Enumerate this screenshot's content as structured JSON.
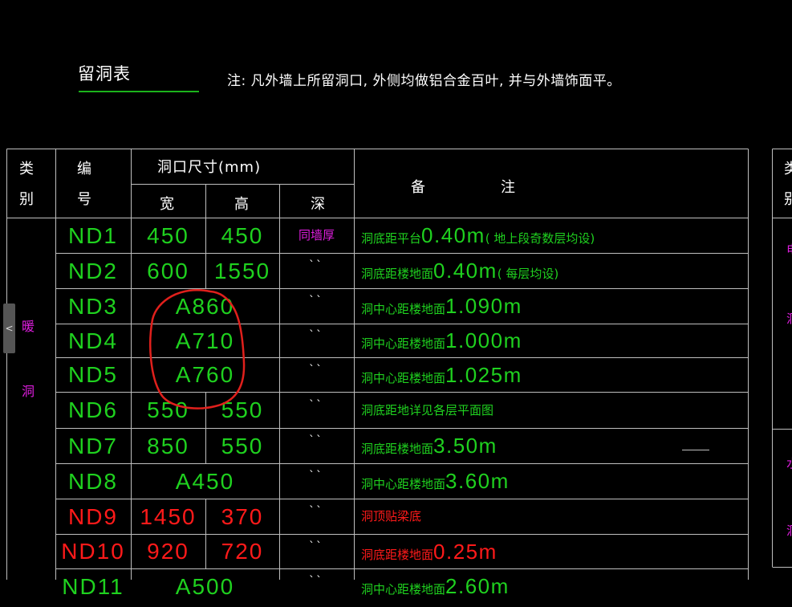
{
  "sheet": {
    "title": "留洞表",
    "note": "注: 凡外墙上所留洞口, 外侧均做铝合金百叶, 并与外墙饰面平。"
  },
  "table": {
    "headers": {
      "category": [
        "类",
        "别"
      ],
      "number": [
        "编",
        "号"
      ],
      "dimension_group": "洞口尺寸(mm)",
      "width": "宽",
      "height": "高",
      "depth": "深",
      "remark_left": "备",
      "remark_right": "注"
    },
    "category_label": [
      "暖",
      "洞"
    ],
    "rows": [
      {
        "id": "ND1",
        "w": "450",
        "h": "450",
        "depth": "同墙厚",
        "remark_cn": "洞底距平台",
        "remark_val": "0.40m",
        "remark_tail": "( 地上段奇数层均设)",
        "color": "#1fd11f"
      },
      {
        "id": "ND2",
        "w": "600",
        "h": "1550",
        "depth": "``",
        "remark_cn": "洞底距楼地面",
        "remark_val": "0.40m",
        "remark_tail": "( 每层均设)",
        "color": "#1fd11f"
      },
      {
        "id": "ND3",
        "merged": "A860",
        "depth": "``",
        "remark_cn": "洞中心距楼地面",
        "remark_val": "1.090m",
        "remark_tail": "",
        "color": "#1fd11f"
      },
      {
        "id": "ND4",
        "merged": "A710",
        "depth": "``",
        "remark_cn": "洞中心距楼地面",
        "remark_val": "1.000m",
        "remark_tail": "",
        "color": "#1fd11f"
      },
      {
        "id": "ND5",
        "merged": "A760",
        "depth": "``",
        "remark_cn": "洞中心距楼地面",
        "remark_val": "1.025m",
        "remark_tail": "",
        "color": "#1fd11f"
      },
      {
        "id": "ND6",
        "w": "550",
        "h": "550",
        "depth": "``",
        "remark_cn": "洞底距地详见各层平面图",
        "remark_val": "",
        "remark_tail": "",
        "color": "#1fd11f"
      },
      {
        "id": "ND7",
        "w": "850",
        "h": "550",
        "depth": "``",
        "remark_cn": "洞底距楼地面",
        "remark_val": "3.50m",
        "remark_tail": "",
        "color": "#1fd11f"
      },
      {
        "id": "ND8",
        "merged": "A450",
        "depth": "``",
        "remark_cn": "洞中心距楼地面",
        "remark_val": "3.60m",
        "remark_tail": "",
        "color": "#1fd11f"
      },
      {
        "id": "ND9",
        "w": "1450",
        "h": "370",
        "depth": "``",
        "remark_cn": "洞顶贴梁底",
        "remark_val": "",
        "remark_tail": "",
        "color": "#ff1a1a"
      },
      {
        "id": "ND10",
        "w": "920",
        "h": "720",
        "depth": "``",
        "remark_cn": "洞底距楼地面",
        "remark_val": "0.25m",
        "remark_tail": "",
        "color": "#ff1a1a"
      },
      {
        "id": "ND11",
        "merged": "A500",
        "depth": "``",
        "remark_cn": "洞中心距楼地面",
        "remark_val": "2.60m",
        "remark_tail": "",
        "color": "#1fd11f"
      }
    ],
    "right_partial": {
      "header": [
        "类",
        "别"
      ],
      "marks": [
        "电",
        "洞",
        "水",
        "洞"
      ]
    }
  },
  "ui": {
    "side_tab_glyph": "<"
  },
  "colors": {
    "line": "#bfbfbf",
    "green": "#1fd11f",
    "red": "#ff1a1a",
    "magenta": "#e01ee0",
    "annotation": "#e0201c"
  }
}
